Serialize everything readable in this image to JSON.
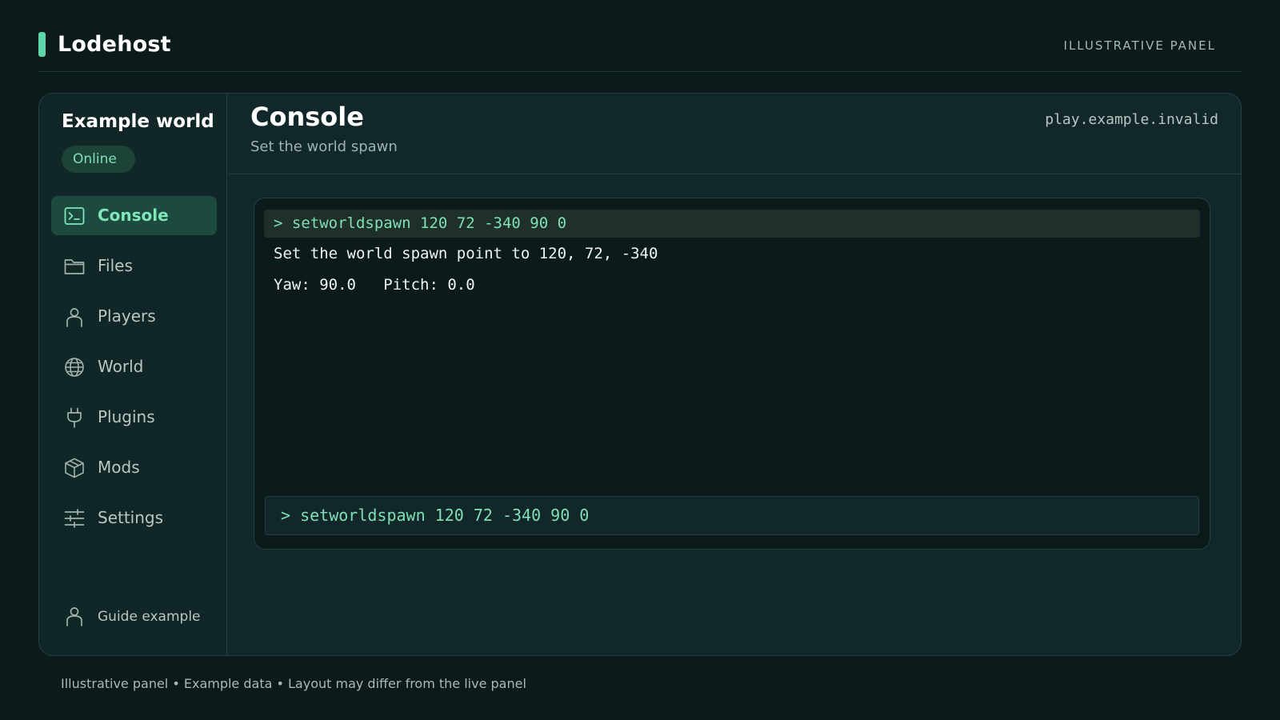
{
  "brand": {
    "name": "Lodehost",
    "tag": "ILLUSTRATIVE PANEL"
  },
  "sidebar": {
    "world_name": "Example world",
    "status": "Online",
    "items": [
      {
        "label": "Console",
        "icon": "terminal-icon",
        "active": true
      },
      {
        "label": "Files",
        "icon": "folder-icon",
        "active": false
      },
      {
        "label": "Players",
        "icon": "user-icon",
        "active": false
      },
      {
        "label": "World",
        "icon": "globe-icon",
        "active": false
      },
      {
        "label": "Plugins",
        "icon": "plug-icon",
        "active": false
      },
      {
        "label": "Mods",
        "icon": "cube-icon",
        "active": false
      },
      {
        "label": "Settings",
        "icon": "sliders-icon",
        "active": false
      }
    ],
    "user": {
      "label": "Guide example",
      "icon": "user-icon"
    }
  },
  "main": {
    "title": "Console",
    "subtitle": "Set the world spawn",
    "host": "play.example.invalid"
  },
  "console": {
    "command_echo": "> setworldspawn 120 72 -340 90 0",
    "lines": [
      "Set the world spawn point to 120, 72, -340",
      "Yaw: 90.0   Pitch: 0.0"
    ],
    "input_value": "> setworldspawn 120 72 -340 90 0"
  },
  "footer": "Illustrative panel • Example data • Layout may differ from the live panel",
  "colors": {
    "accent": "#5fd6a8",
    "background": "#0b1b1c",
    "panel": "#112729"
  }
}
